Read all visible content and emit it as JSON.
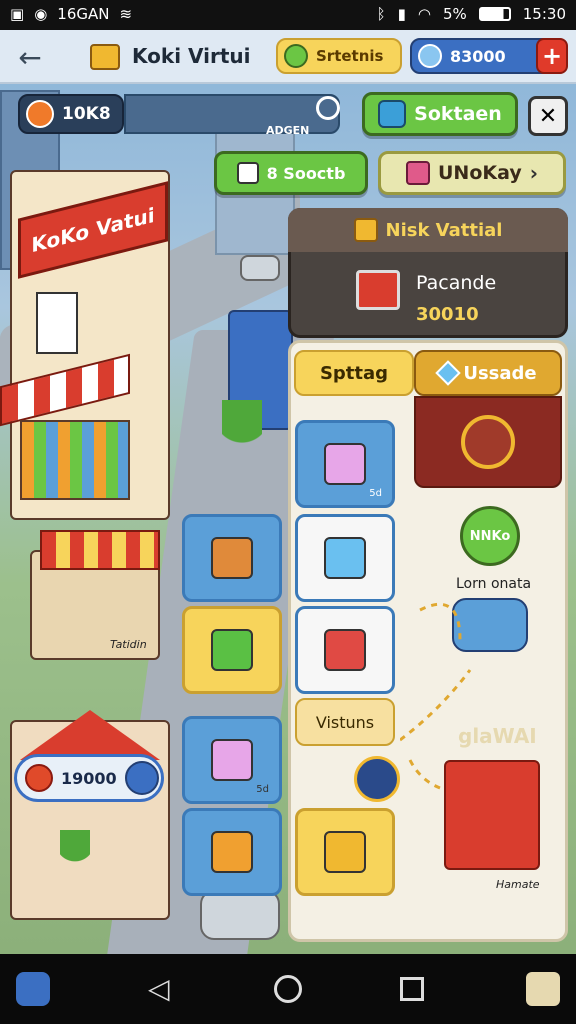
{
  "status": {
    "carrier": "16GAN",
    "battery": "5%",
    "time": "15:30"
  },
  "topbar": {
    "title": "Koki Virtui",
    "chip": "Srtetnis",
    "coins": "83000",
    "add": "+"
  },
  "hud": {
    "score": "10K8",
    "tag": "ADGEN",
    "small": "Soktaen",
    "close": "✕"
  },
  "actions": {
    "a": "8 Sooctb",
    "b": "UNoKay"
  },
  "shopsign": "KoKo Vatui",
  "panel": {
    "title": "Nisk Vattial",
    "item_name": "Pacande",
    "item_price": "30010",
    "tab_a": "Spttag",
    "tab_b": "Ussade",
    "visit_btn": "Vistuns",
    "tile1_tag": "5d",
    "tile_bottom_tag": "5d"
  },
  "map": {
    "badge_label": "Lorn onata",
    "badge_btn": "NNKo",
    "building_tag": "Hamate",
    "ghost": "glaWAI",
    "bottom_left_price": "19000",
    "shop_tag": "Tatidin"
  },
  "colors": {
    "green": "#6bc644",
    "yellow": "#f7d45b",
    "blue": "#5b9fd8",
    "maroon": "#8b2a22"
  }
}
